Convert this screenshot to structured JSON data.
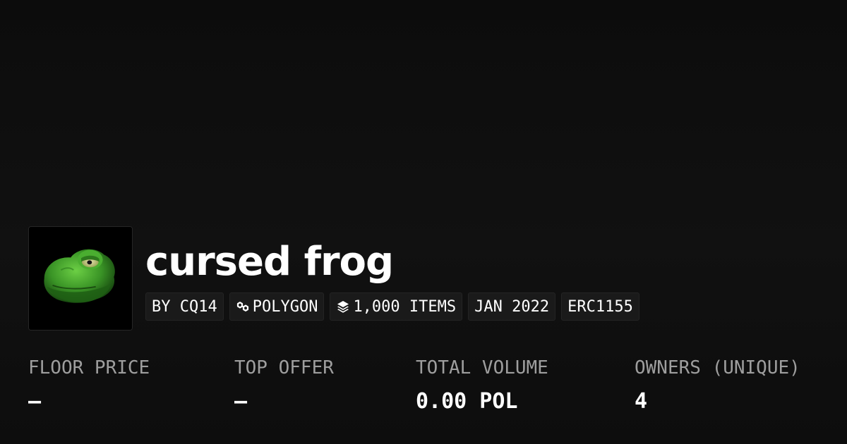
{
  "collection": {
    "name": "cursed frog"
  },
  "tags": [
    {
      "label": "BY CQ14",
      "icon": ""
    },
    {
      "label": "POLYGON",
      "icon": "polygon-chain-icon"
    },
    {
      "label": "1,000 ITEMS",
      "icon": "layers-icon"
    },
    {
      "label": "JAN 2022",
      "icon": ""
    },
    {
      "label": "ERC1155",
      "icon": ""
    }
  ],
  "stats": [
    {
      "label": "FLOOR PRICE",
      "value": "–"
    },
    {
      "label": "TOP OFFER",
      "value": "–"
    },
    {
      "label": "TOTAL VOLUME",
      "value": "0.00 POL"
    },
    {
      "label": "OWNERS (UNIQUE)",
      "value": "4"
    }
  ],
  "colors": {
    "background": "#0d0d0d",
    "tag_background": "#1a1a1a",
    "label_gray": "#9e9e9e",
    "text": "#ffffff",
    "frog_green": "#3f9a2a"
  }
}
